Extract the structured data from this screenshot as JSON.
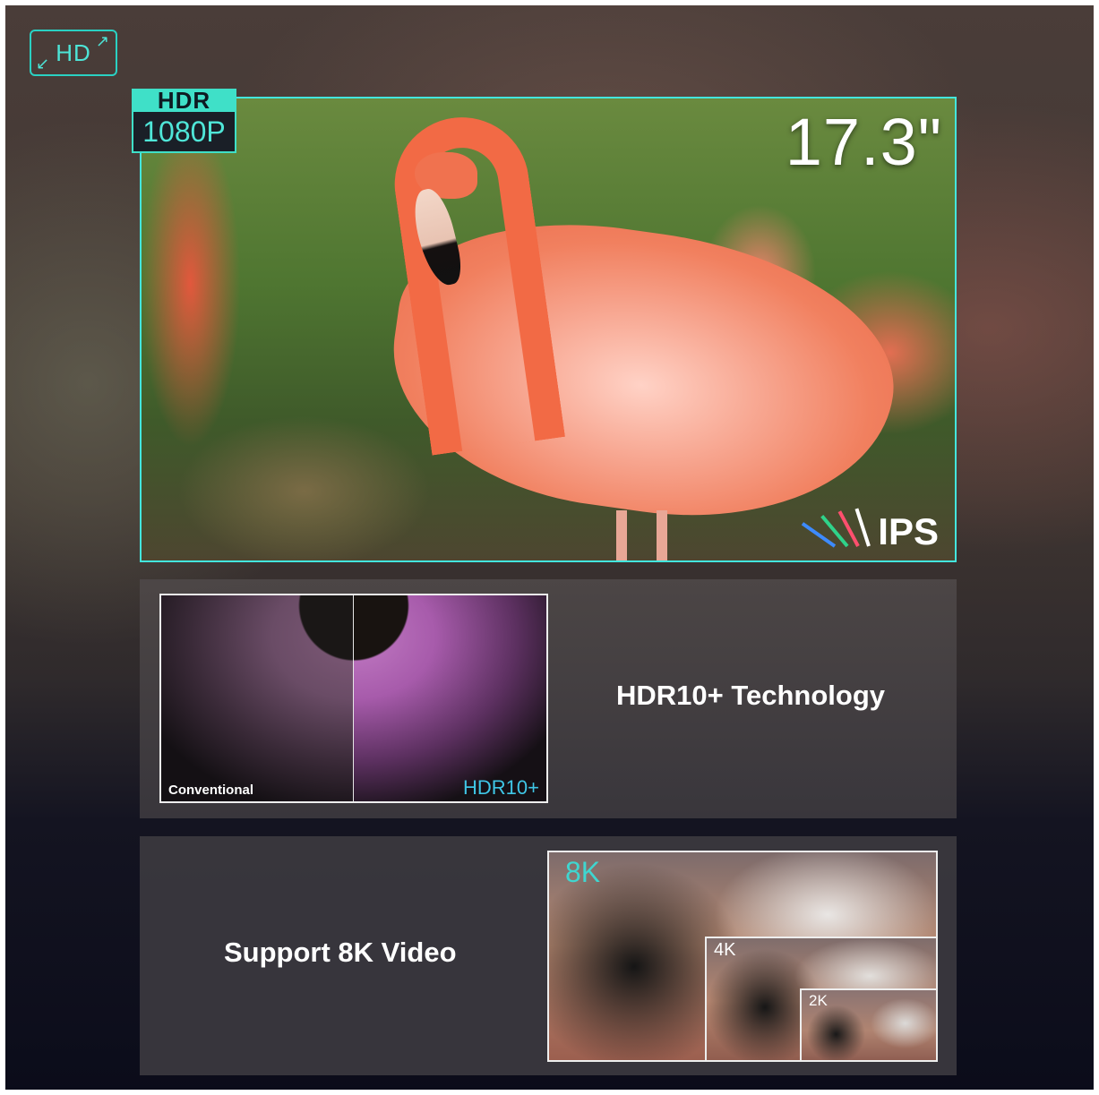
{
  "badges": {
    "hd": "HD",
    "hdr": "HDR",
    "resolution": "1080P"
  },
  "screen": {
    "size": "17.3\"",
    "panel_type": "IPS"
  },
  "hdr_panel": {
    "title": "HDR10+ Technology",
    "label_left": "Conventional",
    "label_right": "HDR10+"
  },
  "video_panel": {
    "title": "Support 8K Video",
    "label_8k": "8K",
    "label_4k": "4K",
    "label_2k": "2K"
  },
  "colors": {
    "accent": "#43e6de",
    "hdr_label": "#3fc6e6"
  }
}
